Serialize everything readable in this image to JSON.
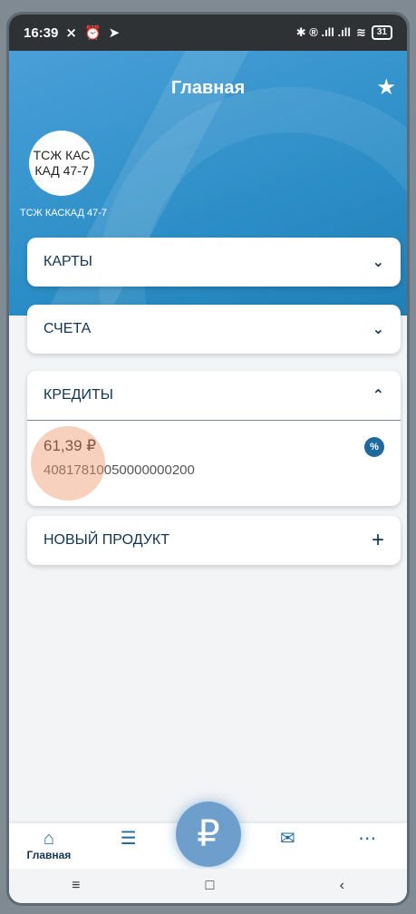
{
  "status_bar": {
    "time": "16:39",
    "left_icons": [
      "mute-icon",
      "alarm-icon",
      "telegram-icon"
    ],
    "right_text": "✱ ® .ıll .ıll",
    "battery": "31"
  },
  "header": {
    "title": "Главная",
    "star_icon": "star-icon",
    "avatar_text": "ТСЖ КАСКАД 47-7",
    "org_name": "ТСЖ КАСКАД 47-7"
  },
  "sections": {
    "cards_label": "КАРТЫ",
    "accounts_label": "СЧЕТА",
    "credits_label": "КРЕДИТЫ",
    "new_product_label": "НОВЫЙ ПРОДУКТ"
  },
  "credit_item": {
    "amount": "61,39 ₽",
    "account_number": "40817810050000000200"
  },
  "bottom_nav": {
    "home_label": "Главная",
    "rub_symbol": "₽"
  },
  "colors": {
    "header_blue": "#2c8ec6",
    "text_dark": "#123553",
    "accent": "#1e6a9e"
  }
}
